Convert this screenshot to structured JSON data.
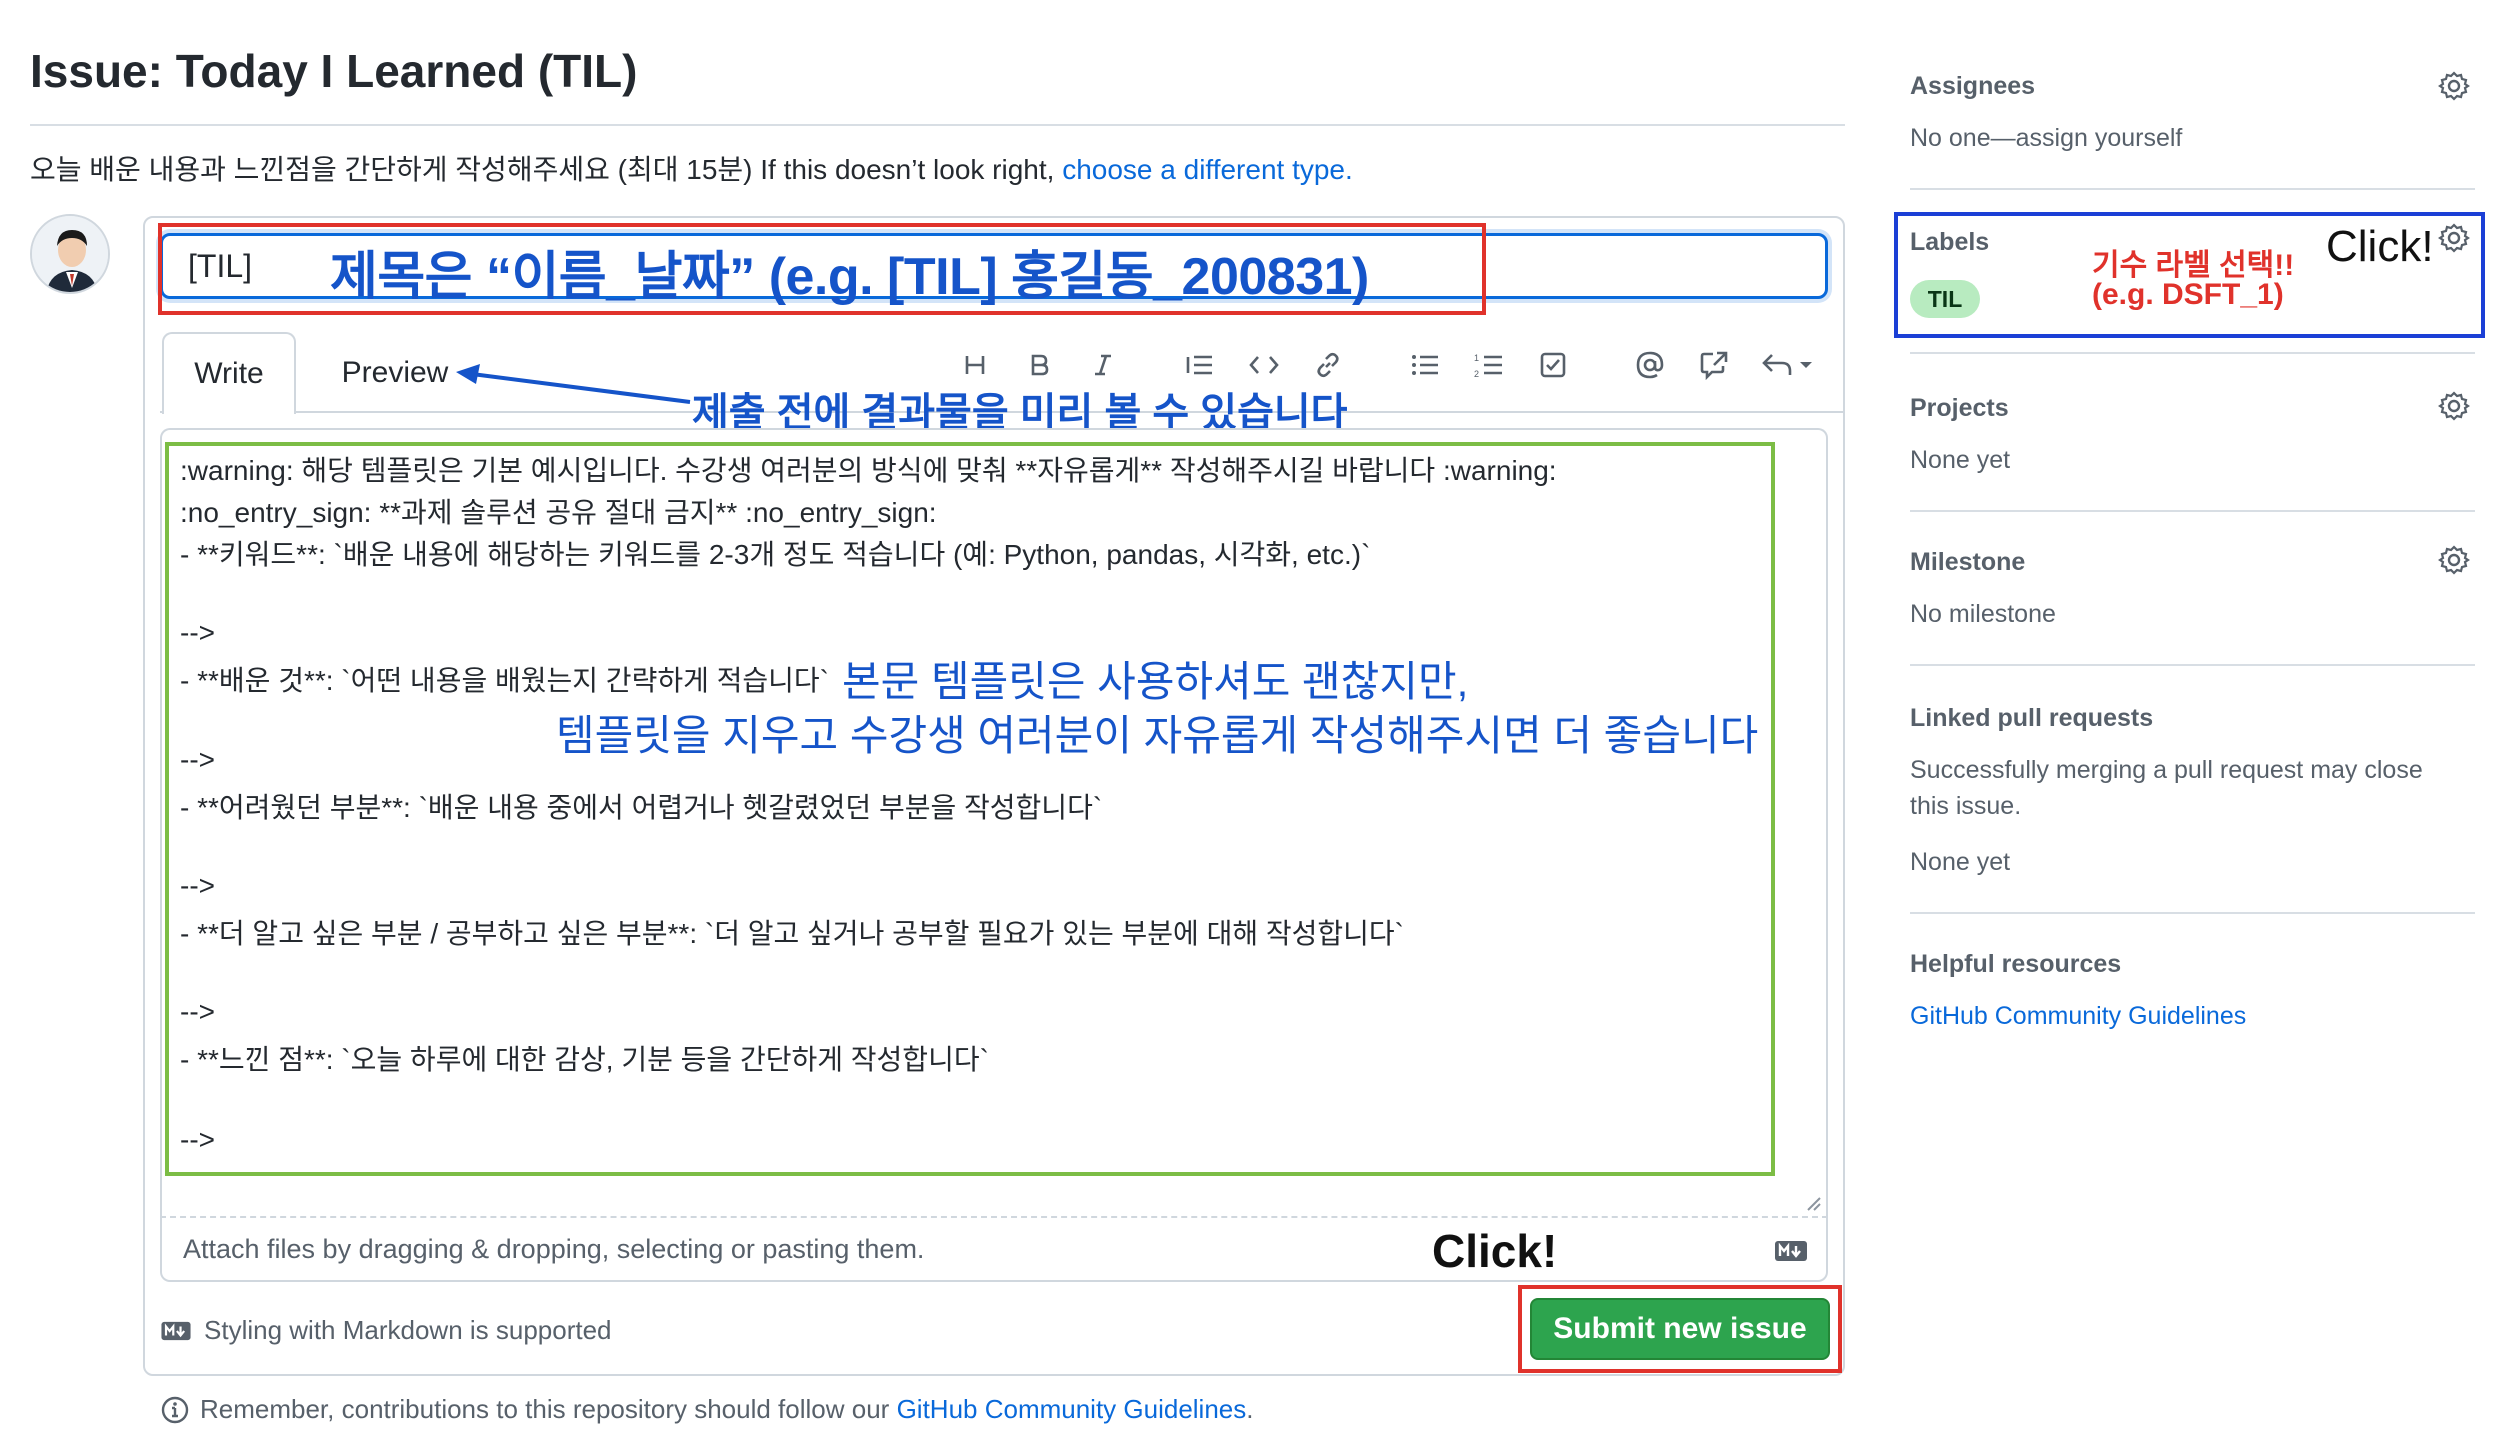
{
  "header": {
    "title": "Issue: Today I Learned (TIL)",
    "description": "오늘 배운 내용과 느낀점을 간단하게 작성해주세요 (최대 15분) If this doesn’t look right, ",
    "description_link": "choose a different type."
  },
  "form": {
    "title_value": "[TIL]",
    "tabs": [
      {
        "label": "Write",
        "active": true
      },
      {
        "label": "Preview",
        "active": false
      }
    ],
    "toolbar": [
      "heading-icon",
      "bold-icon",
      "italic-icon",
      "quote-icon",
      "code-icon",
      "link-icon",
      "unordered-list-icon",
      "ordered-list-icon",
      "task-list-icon",
      "mention-icon",
      "cross-reference-icon",
      "reply-icon"
    ],
    "body_lines": [
      ":warning: 해당 템플릿은 기본 예시입니다. 수강생 여러분의 방식에 맞춰 **자유롭게** 작성해주시길 바랍니다 :warning:",
      ":no_entry_sign: **과제 솔루션 공유 절대 금지** :no_entry_sign:",
      "- **키워드**: `배운 내용에 해당하는 키워드를 2-3개 정도 적습니다 (예: Python, pandas, 시각화, etc.)`",
      "",
      "-->",
      "- **배운 것**: `어떤 내용을 배웠는지 간략하게 적습니다`",
      "-->",
      "- **어려웠던 부분**: `배운 내용 중에서 어렵거나 헷갈렸었던 부분을 작성합니다`",
      "",
      "-->",
      "- **더 알고 싶은 부분 / 공부하고 싶은 부분**: `더 알고 싶거나 공부할 필요가 있는 부분에 대해 작성합니다`",
      "",
      "-->",
      "- **느낀 점**: `오늘 하루에 대한 감상, 기분 등을 간단하게 작성합니다`",
      "",
      "-->"
    ],
    "attach_text": "Attach files by dragging & dropping, selecting or pasting them.",
    "markdown_note": "Styling with Markdown is supported",
    "submit_label": "Submit new issue",
    "remember_text": "Remember, contributions to this repository should follow our ",
    "remember_link": "GitHub Community Guidelines",
    "remember_end": "."
  },
  "annotations": {
    "title_note": "제목은 “이름_날짜” (e.g. [TIL] 홍길동_200831)",
    "preview_note": "제출 전에 결과물을 미리 볼 수 있습니다",
    "body_note_1": "본문 템플릿은 사용하셔도 괜찮지만,",
    "body_note_2": "템플릿을 지우고 수강생 여러분이 자유롭게 작성해주시면 더 좋습니다",
    "click_submit": "Click!",
    "labels_note_1": "기수 라벨 선택!!",
    "labels_note_2": "(e.g. DSFT_1)",
    "click_labels": "Click!"
  },
  "sidebar": {
    "assignees": {
      "heading": "Assignees",
      "value": "No one—assign yourself"
    },
    "labels": {
      "heading": "Labels",
      "badge": "TIL"
    },
    "projects": {
      "heading": "Projects",
      "value": "None yet"
    },
    "milestone": {
      "heading": "Milestone",
      "value": "No milestone"
    },
    "linked": {
      "heading": "Linked pull requests",
      "desc1": "Successfully merging a pull request may close",
      "desc2": "this issue.",
      "value": "None yet"
    },
    "helpful": {
      "heading": "Helpful resources",
      "link": "GitHub Community Guidelines"
    }
  },
  "colors": {
    "accent": "#0969da",
    "submit": "#2da44e",
    "annotation_blue": "#1554c9",
    "annotation_red": "#e0322b",
    "template_outline": "#7cbd45",
    "label_badge": "#b8ebc0"
  }
}
